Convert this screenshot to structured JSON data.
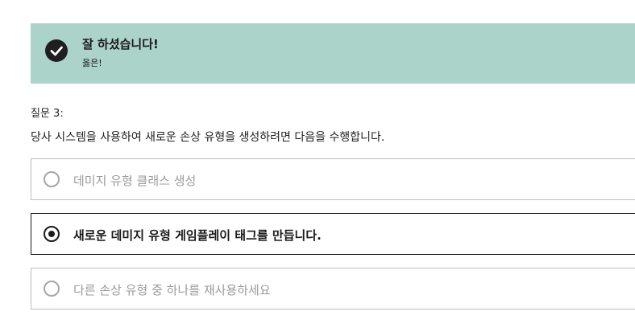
{
  "feedback": {
    "icon": "check-circle-icon",
    "title": "잘 하셨습니다!",
    "subtitle": "옳은!",
    "background": "#abd3ca"
  },
  "question": {
    "label": "질문 3:",
    "text": "당사 시스템을 사용하여 새로운 손상 유형을 생성하려면 다음을 수행합니다.",
    "options": [
      {
        "label": "데미지 유형 클래스 생성",
        "selected": false
      },
      {
        "label": "새로운 데미지 유형 게임플레이 태그를 만듭니다.",
        "selected": true
      },
      {
        "label": "다른 손상 유형 중 하나를 재사용하세요",
        "selected": false
      }
    ]
  }
}
